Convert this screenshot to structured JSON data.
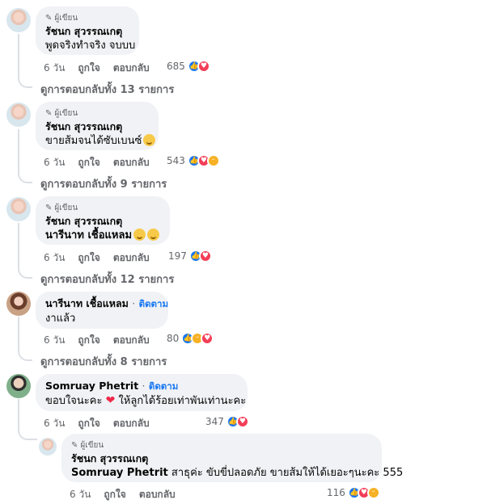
{
  "labels": {
    "badge": "ผู้เขียน",
    "follow": "ติดตาม",
    "like": "ถูกใจ",
    "reply": "ตอบกลับ",
    "time": "6 วัน"
  },
  "comments": [
    {
      "author": "รัชนก สุวรรณเกตุ",
      "text": "พูดจริงทำจริง จบบบ",
      "reactions": "685",
      "viewReplies": "ดูการตอบกลับทั้ง 13 รายการ"
    },
    {
      "author": "รัชนก สุวรรณเกตุ",
      "text": "ขายส้มจนได้ซับเบนซ์",
      "reactions": "543",
      "viewReplies": "ดูการตอบกลับทั้ง 9 รายการ"
    },
    {
      "author": "รัชนก สุวรรณเกตุ",
      "mention": "นารีนาท เชื้อแหลม",
      "reactions": "197",
      "viewReplies": "ดูการตอบกลับทั้ง 12 รายการ"
    },
    {
      "author": "นารีนาท เชื้อแหลม",
      "text": "งาแล้ว",
      "reactions": "80",
      "viewReplies": "ดูการตอบกลับทั้ง 8 รายการ"
    },
    {
      "author": "Somruay Phetrit",
      "text_a": "ขอบใจนะคะ ",
      "text_b": " ให้ลูกได้ร้อยเท่าพันเท่านะคะ",
      "reactions": "347"
    },
    {
      "author": "รัชนก สุวรรณเกตุ",
      "mention": "Somruay Phetrit",
      "text": " สาธุค่ะ ขับขี่ปลอดภัย ขายส้มให้ได้เยอะๆนะคะ 555",
      "reactions": "116"
    }
  ],
  "icons": {
    "pen": "pencil-icon",
    "like": "like-reaction-icon",
    "love": "love-reaction-icon",
    "haha": "haha-reaction-icon",
    "heart": "heart-emoji"
  },
  "colors": {
    "bubble": "#f0f2f5",
    "link": "#1877f2",
    "meta": "#65676b",
    "like": "#1877f2",
    "love": "#f33e58"
  }
}
